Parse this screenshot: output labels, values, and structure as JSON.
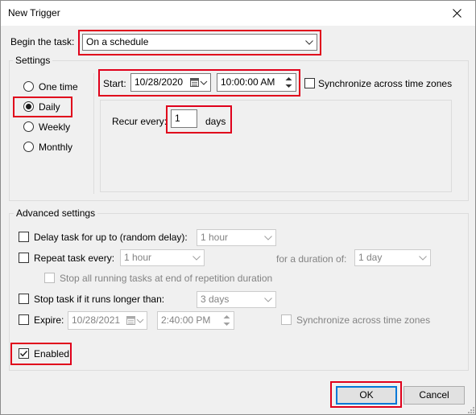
{
  "window": {
    "title": "New Trigger",
    "close_glyph": "✕"
  },
  "begin": {
    "label": "Begin the task:",
    "value": "On a schedule"
  },
  "settings": {
    "label": "Settings",
    "schedule_options": [
      "One time",
      "Daily",
      "Weekly",
      "Monthly"
    ],
    "selected": "Daily",
    "start_label": "Start:",
    "start_date": "10/28/2020",
    "start_time": "10:00:00 AM",
    "sync_label": "Synchronize across time zones",
    "sync_checked": false,
    "recur_label": "Recur every:",
    "recur_value": "1",
    "recur_unit": "days"
  },
  "advanced": {
    "label": "Advanced settings",
    "delay_label": "Delay task for up to (random delay):",
    "delay_value": "1 hour",
    "repeat_label": "Repeat task every:",
    "repeat_value": "1 hour",
    "duration_label": "for a duration of:",
    "duration_value": "1 day",
    "stop_all_label": "Stop all running tasks at end of repetition duration",
    "stop_longer_label": "Stop task if it runs longer than:",
    "stop_longer_value": "3 days",
    "expire_label": "Expire:",
    "expire_date": "10/28/2021",
    "expire_time": "2:40:00 PM",
    "expire_sync_label": "Synchronize across time zones",
    "enabled_label": "Enabled",
    "enabled_checked": true
  },
  "buttons": {
    "ok": "OK",
    "cancel": "Cancel"
  },
  "colors": {
    "highlight": "#e0001b",
    "accent": "#0078d7"
  }
}
